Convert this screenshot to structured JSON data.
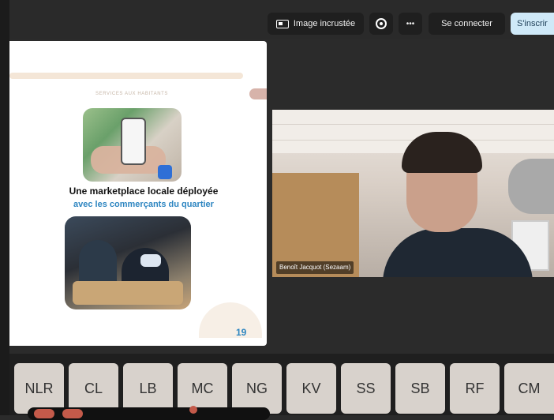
{
  "toolbar": {
    "pip_label": "Image incrustée",
    "more_label": "•••",
    "login_label": "Se connecter",
    "signup_label": "S'inscrir"
  },
  "slide": {
    "kicker": "SERVICES AUX HABITANTS",
    "title_line1": "Une marketplace locale déployée",
    "title_line2": "avec les commerçants du quartier",
    "page_number": "19"
  },
  "video": {
    "name_tag": "Benoît Jacquot (Sezaam)"
  },
  "participants": [
    {
      "initials": "NLR"
    },
    {
      "initials": "CL"
    },
    {
      "initials": "LB"
    },
    {
      "initials": "MC"
    },
    {
      "initials": "NG"
    },
    {
      "initials": "KV"
    },
    {
      "initials": "SS"
    },
    {
      "initials": "SB"
    },
    {
      "initials": "RF"
    },
    {
      "initials": "CM"
    }
  ]
}
